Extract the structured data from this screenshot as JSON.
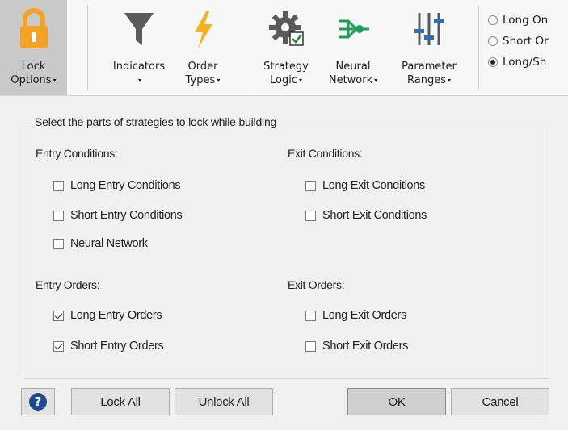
{
  "ribbon": {
    "lock_options": {
      "line1": "Lock",
      "line2": "Options"
    },
    "indicators": {
      "line1": "Indicators"
    },
    "order_types": {
      "line1": "Order",
      "line2": "Types"
    },
    "strategy_logic": {
      "line1": "Strategy",
      "line2": "Logic"
    },
    "neural_network": {
      "line1": "Neural",
      "line2": "Network"
    },
    "parameter_ranges": {
      "line1": "Parameter",
      "line2": "Ranges"
    },
    "dropdown_arrow": "▾",
    "radios": [
      {
        "label": "Long On",
        "selected": false
      },
      {
        "label": "Short Or",
        "selected": false
      },
      {
        "label": "Long/Sh",
        "selected": true
      }
    ]
  },
  "dialog": {
    "group_title": "Select the parts of strategies to lock while building",
    "entry_conditions": {
      "header": "Entry Conditions:",
      "items": [
        {
          "label": "Long Entry Conditions",
          "checked": false
        },
        {
          "label": "Short Entry Conditions",
          "checked": false
        },
        {
          "label": "Neural Network",
          "checked": false
        }
      ]
    },
    "exit_conditions": {
      "header": "Exit Conditions:",
      "items": [
        {
          "label": "Long Exit Conditions",
          "checked": false
        },
        {
          "label": "Short Exit Conditions",
          "checked": false
        }
      ]
    },
    "entry_orders": {
      "header": "Entry Orders:",
      "items": [
        {
          "label": "Long Entry Orders",
          "checked": true
        },
        {
          "label": "Short Entry Orders",
          "checked": true
        }
      ]
    },
    "exit_orders": {
      "header": "Exit Orders:",
      "items": [
        {
          "label": "Long Exit Orders",
          "checked": false
        },
        {
          "label": "Short Exit Orders",
          "checked": false
        }
      ]
    }
  },
  "buttons": {
    "help": "?",
    "lock_all": "Lock All",
    "unlock_all": "Unlock All",
    "ok": "OK",
    "cancel": "Cancel"
  },
  "colors": {
    "lock_icon": "#f4a223",
    "order_types_icon": "#f4b223",
    "neural_network_icon": "#1aa05a",
    "parameter_ranges_icon": "#2d6fb8",
    "help_icon": "#1f4a8c"
  }
}
